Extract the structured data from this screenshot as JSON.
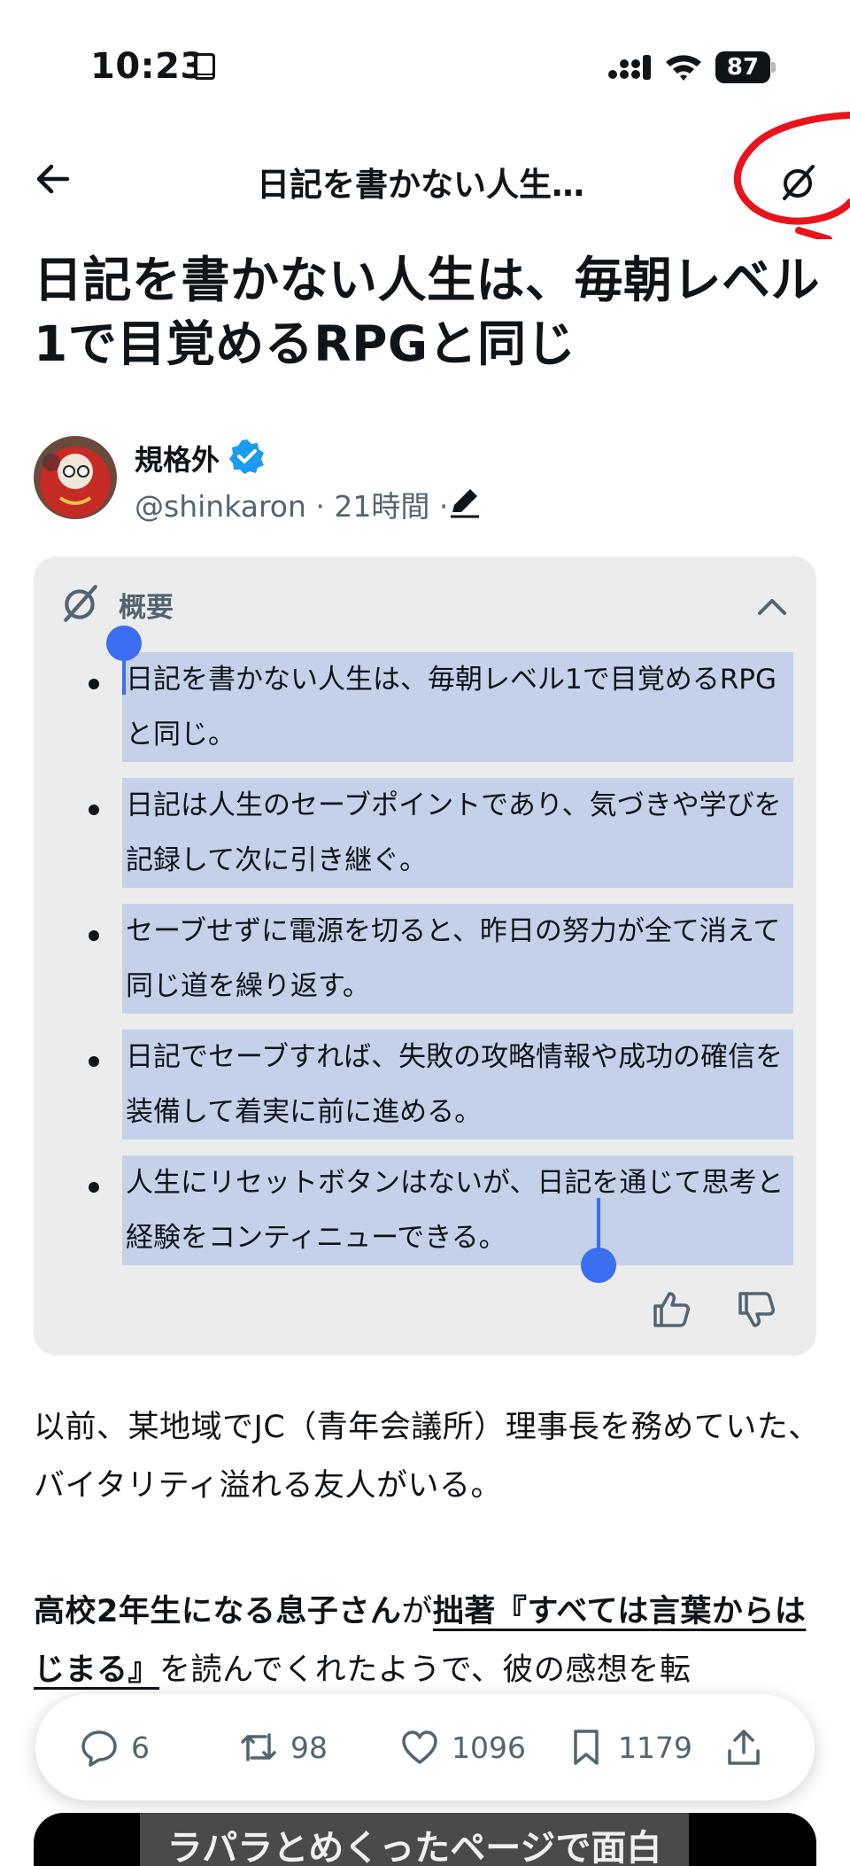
{
  "status_bar": {
    "time": "10:23",
    "battery": "87"
  },
  "header": {
    "title": "日記を書かない人生…"
  },
  "article": {
    "title": "日記を書かない人生は、毎朝レベル1で目覚めるRPGと同じ",
    "author": {
      "name": "規格外",
      "handle": "@shinkaron",
      "time": "21時間",
      "sep": " · "
    }
  },
  "summary": {
    "title": "概要",
    "items": [
      "日記を書かない人生は、毎朝レベル1で目覚めるRPGと同じ。",
      "日記は人生のセーブポイントであり、気づきや学びを記録して次に引き継ぐ。",
      "セーブせずに電源を切ると、昨日の努力が全て消えて同じ道を繰り返す。",
      "日記でセーブすれば、失敗の攻略情報や成功の確信を装備して着実に前に進める。",
      "人生にリセットボタンはないが、日記を通じて思考と経験をコンティニューできる。"
    ]
  },
  "body": {
    "p1": "以前、某地域でJC（青年会議所）理事長を務めていた、バイタリティ溢れる友人がいる。",
    "p2_bold": "高校2年生になる息子さん",
    "p2_connector": "が",
    "p2_link": "拙著『すべては言葉からはじまる』",
    "p2_rest": "を読んでくれたようで、彼の感想を転"
  },
  "actions": {
    "replies": "6",
    "retweets": "98",
    "likes": "1096",
    "bookmarks": "1179"
  },
  "video": {
    "caption": "ラパラとめくったページで面白"
  },
  "icons": {
    "back": "arrow-left-icon",
    "grok": "grok-icon",
    "verified": "verified-badge-icon",
    "edit": "edit-icon",
    "collapse": "chevron-up-icon",
    "thumbs_up": "thumbs-up-icon",
    "thumbs_down": "thumbs-down-icon",
    "reply": "reply-icon",
    "retweet": "retweet-icon",
    "like": "heart-icon",
    "bookmark": "bookmark-icon",
    "share": "share-icon"
  },
  "colors": {
    "selection": "#c5d1ea",
    "handle": "#3b6ef0",
    "verified": "#1d9bf0",
    "annotation": "#e8141c",
    "muted": "#536471"
  }
}
